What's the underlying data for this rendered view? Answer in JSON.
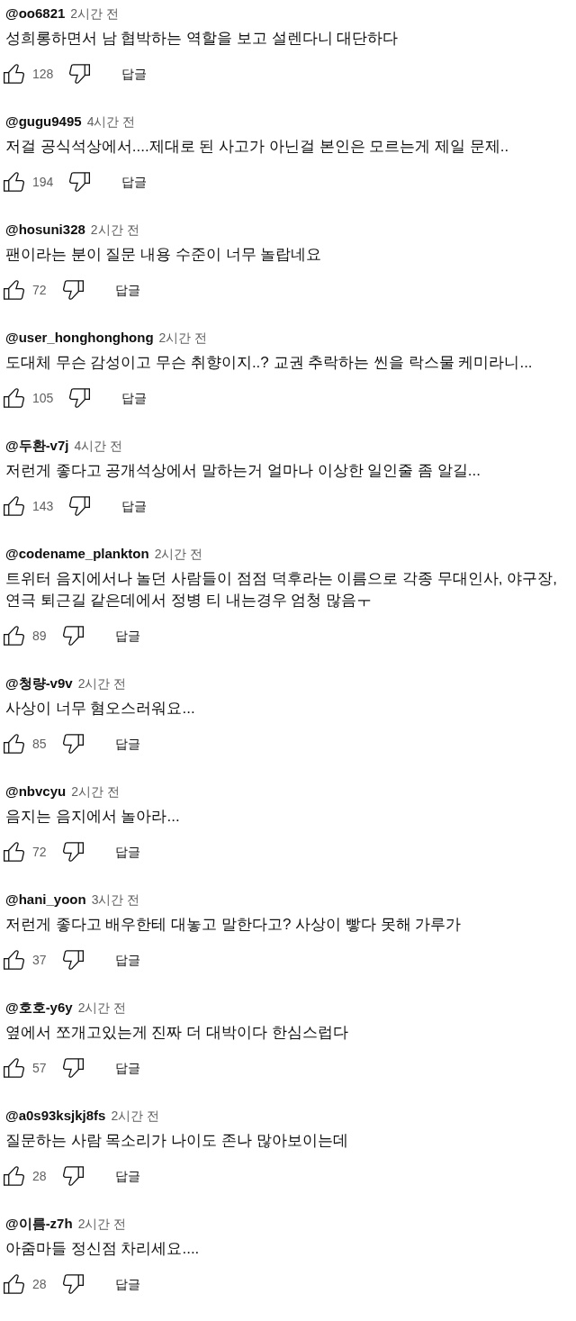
{
  "comments": [
    {
      "author": "@oo6821",
      "time": "2시간 전",
      "text": "성희롱하면서 남 협박하는 역할을 보고 설렌다니 대단하다",
      "likes": "128",
      "reply": "답글"
    },
    {
      "author": "@gugu9495",
      "time": "4시간 전",
      "text": "저걸 공식석상에서....제대로 된 사고가 아닌걸 본인은 모르는게 제일 문제..",
      "likes": "194",
      "reply": "답글"
    },
    {
      "author": "@hosuni328",
      "time": "2시간 전",
      "text": "팬이라는 분이 질문 내용 수준이 너무 놀랍네요",
      "likes": "72",
      "reply": "답글"
    },
    {
      "author": "@user_honghonghong",
      "time": "2시간 전",
      "text": "도대체 무슨 감성이고 무슨 취향이지..? 교권 추락하는 씬을 락스물 케미라니...",
      "likes": "105",
      "reply": "답글"
    },
    {
      "author": "@두환-v7j",
      "time": "4시간 전",
      "text": "저런게 좋다고 공개석상에서 말하는거 얼마나 이상한 일인줄 좀 알길...",
      "likes": "143",
      "reply": "답글"
    },
    {
      "author": "@codename_plankton",
      "time": "2시간 전",
      "text": "트위터 음지에서나 놀던 사람들이 점점 덕후라는 이름으로 각종 무대인사, 야구장, 연극 퇴근길 같은데에서 정병 티 내는경우 엄청 많음ㅜ",
      "likes": "89",
      "reply": "답글"
    },
    {
      "author": "@청량-v9v",
      "time": "2시간 전",
      "text": "사상이 너무 혐오스러워요...",
      "likes": "85",
      "reply": "답글"
    },
    {
      "author": "@nbvcyu",
      "time": "2시간 전",
      "text": "음지는 음지에서 놀아라...",
      "likes": "72",
      "reply": "답글"
    },
    {
      "author": "@hani_yoon",
      "time": "3시간 전",
      "text": "저런게 좋다고 배우한테 대놓고 말한다고? 사상이 빻다 못해 가루가",
      "likes": "37",
      "reply": "답글"
    },
    {
      "author": "@호호-y6y",
      "time": "2시간 전",
      "text": "옆에서 쪼개고있는게 진짜 더 대박이다 한심스럽다",
      "likes": "57",
      "reply": "답글"
    },
    {
      "author": "@a0s93ksjkj8fs",
      "time": "2시간 전",
      "text": "질문하는 사람 목소리가 나이도 존나 많아보이는데",
      "likes": "28",
      "reply": "답글"
    },
    {
      "author": "@이름-z7h",
      "time": "2시간 전",
      "text": "아줌마들 정신점 차리세요....",
      "likes": "28",
      "reply": "답글"
    }
  ]
}
